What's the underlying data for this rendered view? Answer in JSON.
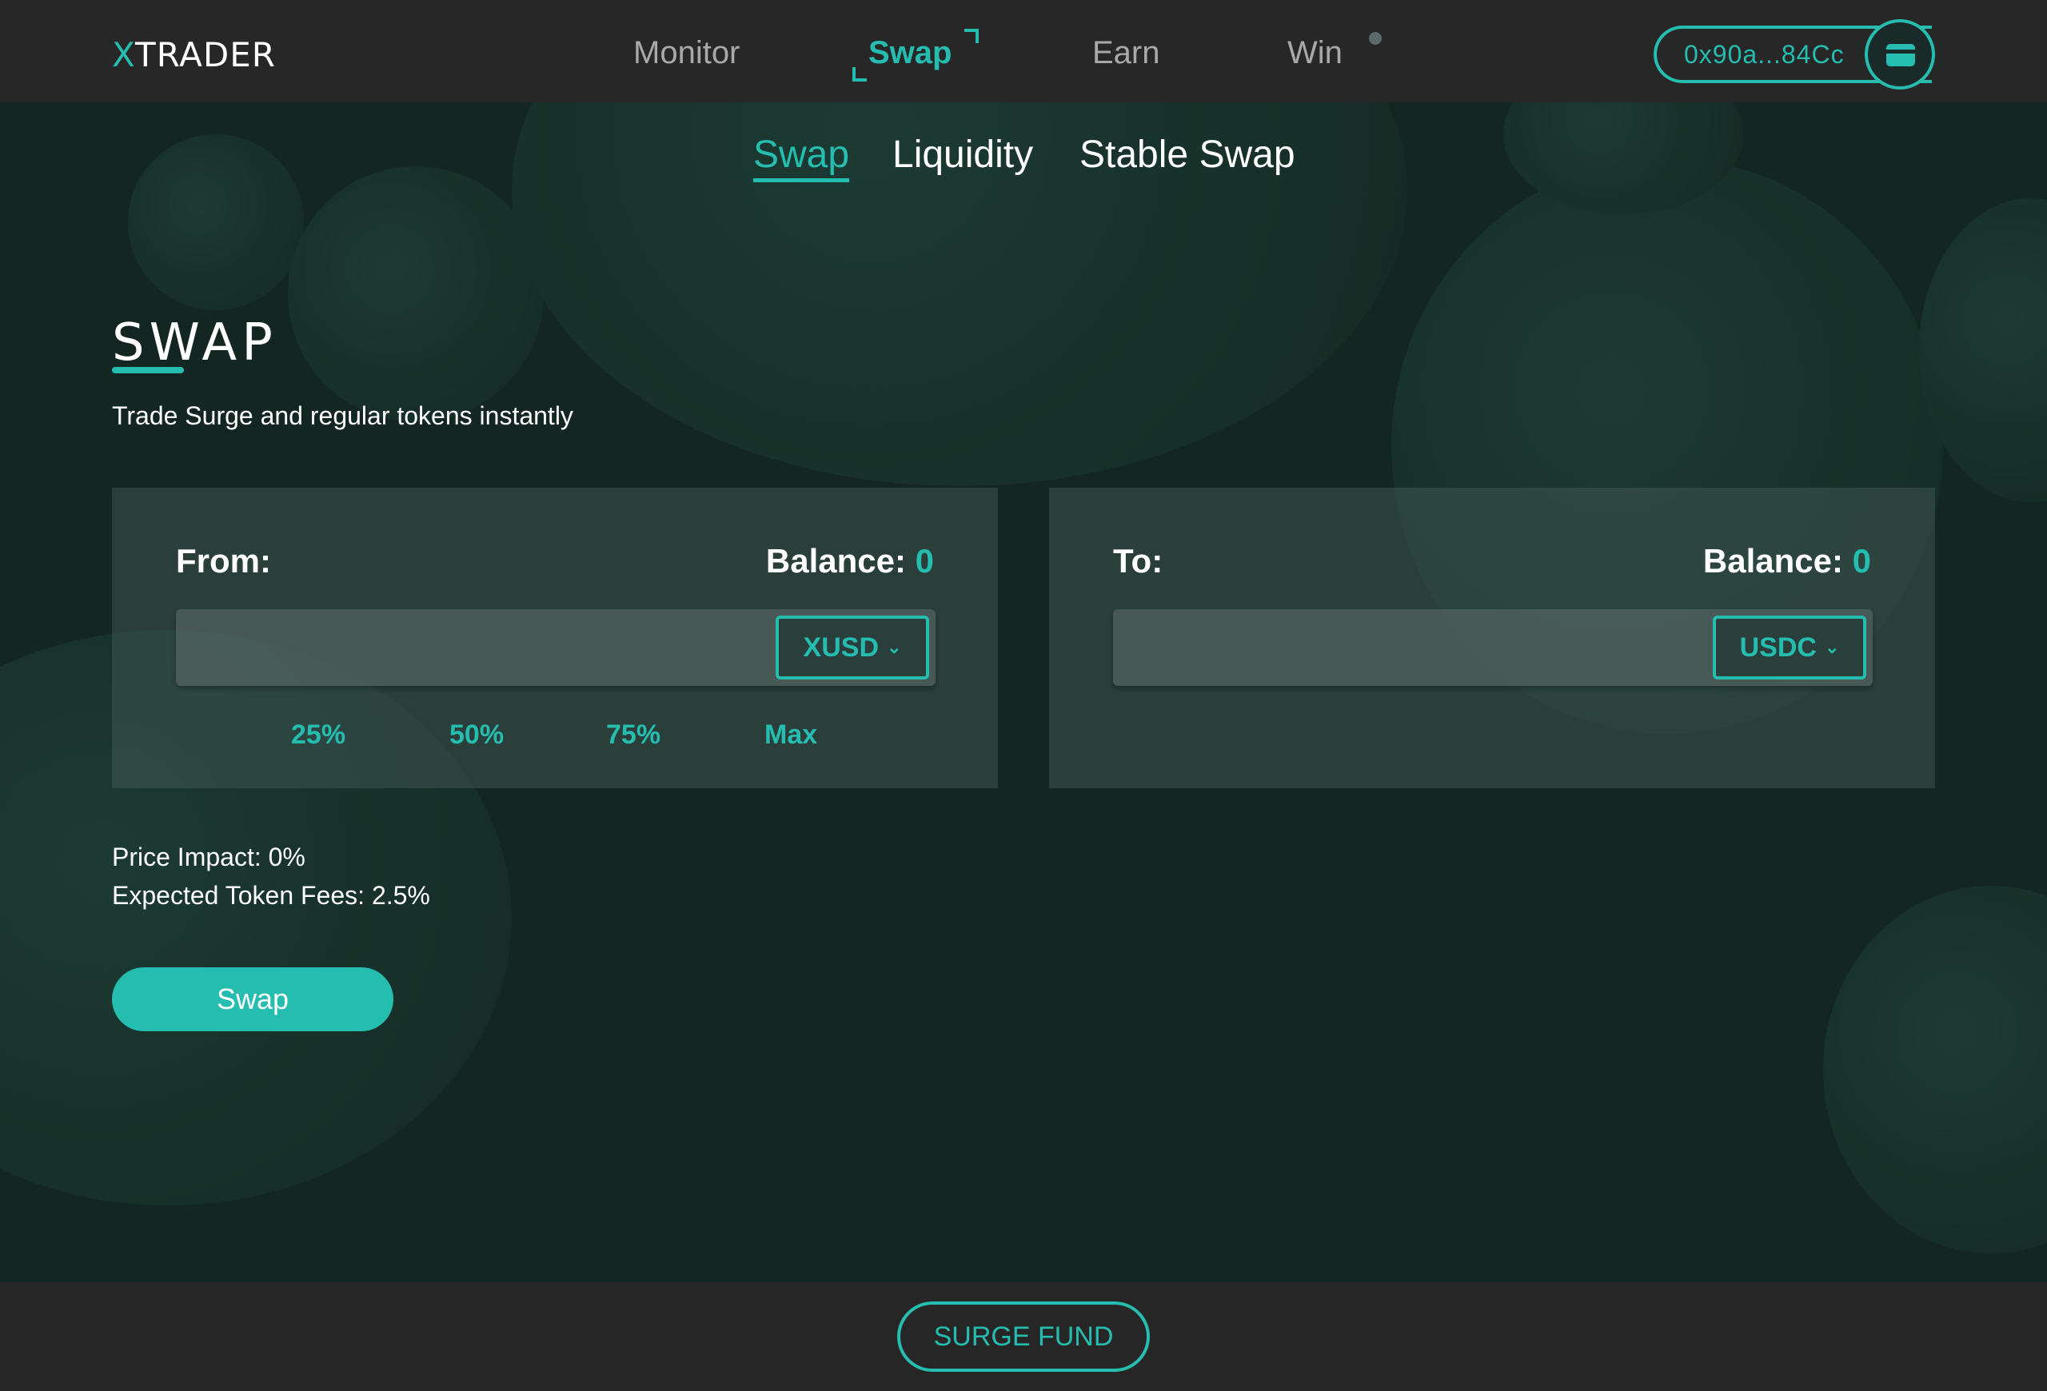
{
  "header": {
    "logo_x": "X",
    "logo_rest": "TRADER",
    "nav": [
      {
        "label": "Monitor",
        "active": false
      },
      {
        "label": "Swap",
        "active": true
      },
      {
        "label": "Earn",
        "active": false
      },
      {
        "label": "Win",
        "active": false
      }
    ],
    "wallet_address": "0x90a...84Cc",
    "wallet_icon": "wallet-card-icon"
  },
  "subtabs": [
    {
      "label": "Swap",
      "active": true
    },
    {
      "label": "Liquidity",
      "active": false
    },
    {
      "label": "Stable Swap",
      "active": false
    }
  ],
  "page": {
    "title": "SWAP",
    "description": "Trade Surge and regular tokens instantly"
  },
  "from_panel": {
    "label": "From:",
    "balance_label": "Balance:",
    "balance_value": "0",
    "amount_value": "",
    "token": "XUSD",
    "percent_options": [
      "25%",
      "50%",
      "75%",
      "Max"
    ]
  },
  "to_panel": {
    "label": "To:",
    "balance_label": "Balance:",
    "balance_value": "0",
    "amount_value": "",
    "token": "USDC"
  },
  "info": {
    "price_impact": "Price Impact: 0%",
    "expected_fees": "Expected Token Fees: 2.5%"
  },
  "swap_button": "Swap",
  "footer": {
    "fund_button": "SURGE FUND"
  },
  "colors": {
    "accent": "#26bdb1",
    "background": "#132621",
    "bar": "#272727"
  }
}
